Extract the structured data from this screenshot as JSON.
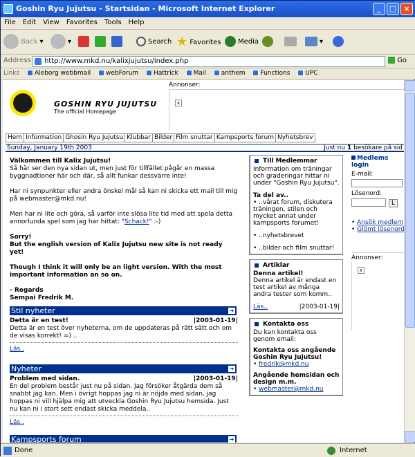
{
  "window": {
    "title": "Goshin Ryu Jujutsu - Startsidan - Microsoft Internet Explorer"
  },
  "menu": [
    "File",
    "Edit",
    "View",
    "Favorites",
    "Tools",
    "Help"
  ],
  "toolbar": {
    "back": "Back",
    "search": "Search",
    "favorites": "Favorites",
    "media": "Media"
  },
  "address": {
    "label": "Address",
    "url": "http://www.mkd.nu/kalixjujutsu/index.php",
    "go": "Go"
  },
  "links": {
    "label": "Links",
    "items": [
      "Aleborg webbmail",
      "webForum",
      "Hattrick",
      "Mail",
      "anthem",
      "Functions",
      "UPC"
    ]
  },
  "site": {
    "name": "GOSHIN RYU JUJUTSU",
    "sub": "The official Homepage",
    "ads_label": "Annonser:",
    "broken": "x"
  },
  "nav": [
    "Hem",
    "Information",
    "Ghosin Ryu Jujutsu",
    "Klubbar",
    "Bilder",
    "Film snuttar",
    "Kampsports forum",
    "Nyhetsbrev"
  ],
  "dateline": {
    "date": "Sunday, January 19th 2003",
    "visitors_pre": "Just nu ",
    "visitors_count": "1",
    "visitors_post": " besökare på sid"
  },
  "welcome": {
    "p1_bold": "Välkommen till Kalix Jujutsu!",
    "p1": "Så här ser den nya sidan ut, men just för tillfället pågår en massa byggnadtioner här och där, så allt funkar dessvärre inte!",
    "p2": "Har ni synpunkter eller andra önskel mål så kan ni skicka ett mail till mig på webmaster@mkd.nu!",
    "p3_pre": "Men har ni lite och göra, så varför inte slösa lite tid med att spela detta annorlunda spel som jag har hittat: \"",
    "p3_link": "Schack!",
    "p3_post": "\" :-)",
    "p4a": "Sorry!",
    "p4b": "But the english version of Kalix Jujutsu new site is not ready yet!",
    "p5": "Though I think it will only be an light version. With the most important information an so on.",
    "sign1": "- Regards",
    "sign2": "Sempai Fredrik M."
  },
  "sections": {
    "stil": {
      "title": "Stil nyheter",
      "art_title": "Detta är en test!",
      "art_date": "|2003-01-19|",
      "art_body": "Detta är en test över nyheterna, om de uppdateras på rätt sätt och om de visas korrekt! =) ..",
      "more": "Läs.."
    },
    "nyheter": {
      "title": "Nyheter",
      "art_title": "Problem med sidan.",
      "art_date": "|2003-01-19|",
      "art_body": "En del problem består just nu på sidan. Jag försöker åtgärda dem så snabbt jag kan. Men i övrigt hoppas jag ni är nöjda med sidan, jag hoppas ni vill hjälpa mig att utveckla Goshin Ryu Jujutsu hemsida. Just nu kan ni i stort sett endast skicka meddela..",
      "more": "Läs.."
    },
    "forum": {
      "title": "Kampsports forum"
    }
  },
  "members": {
    "title": "Till Medlemmar",
    "body": "Information om träningar och graderingar hittar ni under \"Goshin Ryu Jujutsu\".",
    "sub": "Ta del av..",
    "b1": "• ..vårat forum, diskutera träningen, stilen och mycket annat under kampsports forumet!",
    "b2": "• ..nyhetsbrevet",
    "b3": "• ..bilder och film snuttar!"
  },
  "articles": {
    "title": "Artiklar",
    "sub": "Denna artikel!",
    "body": "Denna artikel är endast en test artikel av många andra tester som komm..",
    "more": "Läs..",
    "date": "|2003-01-19|"
  },
  "contact": {
    "title": "Kontakta oss",
    "body": "Du kan kontakta oss genom email:",
    "s1": "Kontakta oss angående Goshin Ryu Jujutsu!",
    "e1": "fredrik@mkd.nu",
    "s2": "Angående hemsidan och design m.m.",
    "e2": "webmaster@mkd.nu"
  },
  "login": {
    "title": "Medlems login",
    "email": "E-mail:",
    "password": "Lösenord:",
    "btn": "L",
    "apply": "Ansök medlem",
    "forgot": "Glömt lösenord",
    "ads": "Annonser:"
  },
  "status": {
    "left": "Done",
    "right": "Internet"
  }
}
